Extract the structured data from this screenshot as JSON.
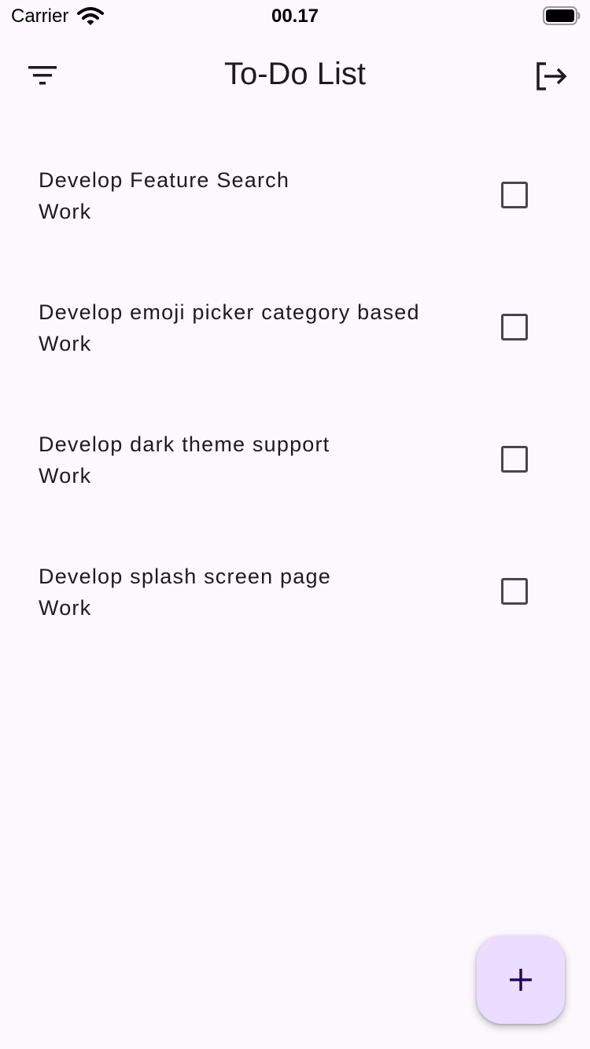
{
  "status_bar": {
    "carrier": "Carrier",
    "time": "00.17",
    "icons": [
      "wifi-icon",
      "battery-icon"
    ]
  },
  "app_bar": {
    "title": "To-Do List",
    "left_icon": "filter-icon",
    "right_icon": "logout-icon"
  },
  "todos": [
    {
      "title": "Develop Feature Search",
      "category": "Work",
      "checked": false
    },
    {
      "title": "Develop emoji picker category based",
      "category": "Work",
      "checked": false
    },
    {
      "title": "Develop dark theme support",
      "category": "Work",
      "checked": false
    },
    {
      "title": "Develop splash screen page",
      "category": "Work",
      "checked": false
    }
  ],
  "fab": {
    "icon": "plus-icon"
  },
  "colors": {
    "background": "#FDF7FE",
    "fab_background": "#EADDFF",
    "fab_icon": "#21005D",
    "text": "#1D1B20",
    "checkbox_border": "#49454F"
  }
}
